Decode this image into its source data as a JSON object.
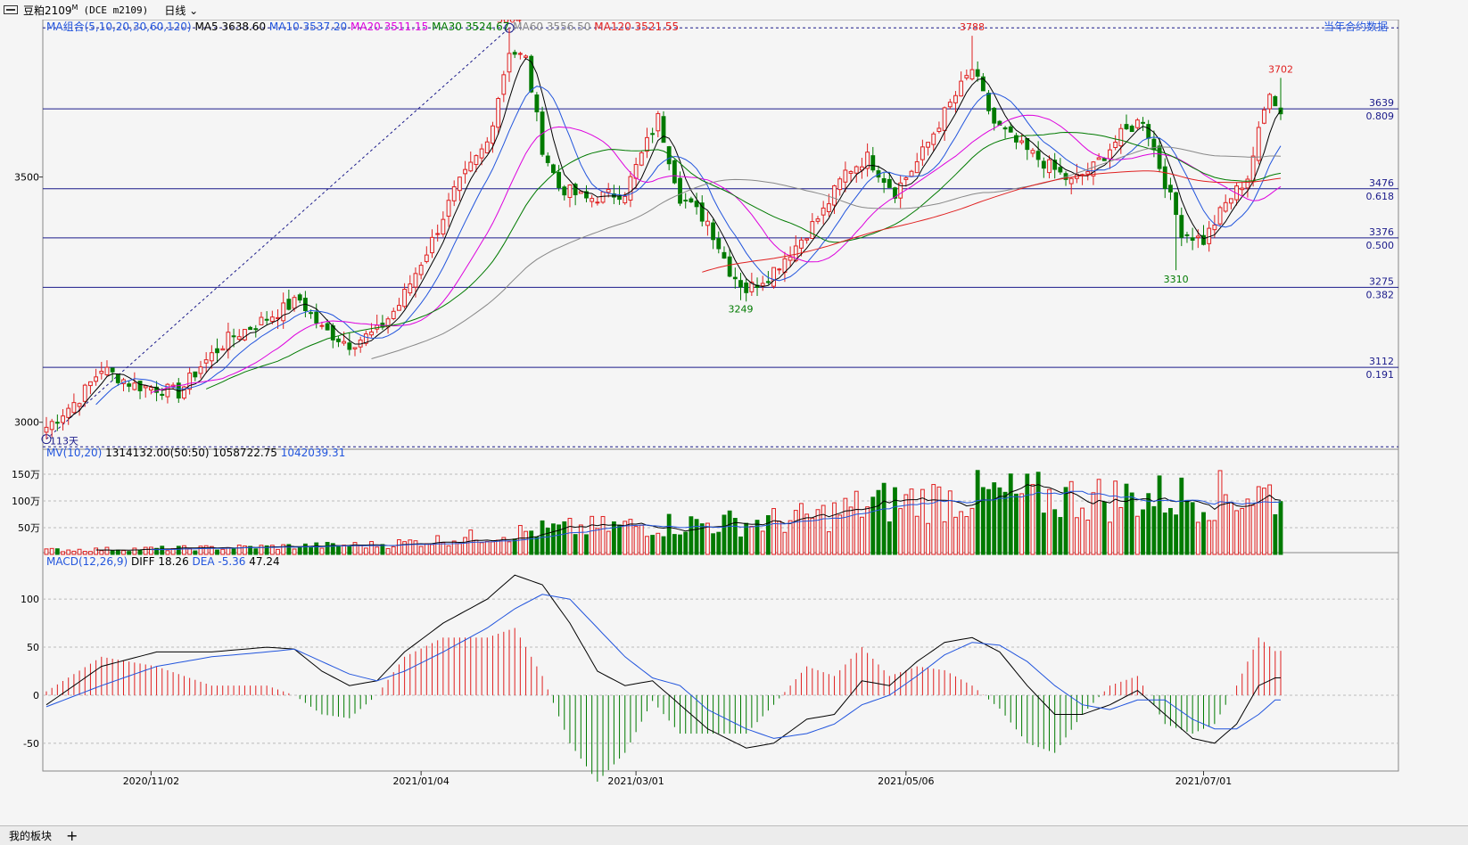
{
  "title": {
    "symbol": "豆粕2109",
    "superscript": "M",
    "code": "(DCE m2109)",
    "period": "日线"
  },
  "footer": {
    "tab": "我的板块",
    "add": "+"
  },
  "colors": {
    "up": "#e02020",
    "down": "#007a00",
    "ma5": "#000000",
    "ma10": "#2255dd",
    "ma20": "#dd00dd",
    "ma30": "#007a00",
    "ma60": "#888888",
    "ma120": "#e02020",
    "grid": "#bbbbbb",
    "fib": "#1a1a8a"
  },
  "chart_data": [
    {
      "type": "candlestick",
      "panel": "price",
      "indicator_label": "MA组合(5,10,20,30,60,120)",
      "legend": [
        {
          "name": "MA5",
          "value": "3638.60",
          "color": "#000000"
        },
        {
          "name": "MA10",
          "value": "3537.20",
          "color": "#2255dd"
        },
        {
          "name": "MA20",
          "value": "3511.15",
          "color": "#dd00dd"
        },
        {
          "name": "MA30",
          "value": "3524.67",
          "color": "#007a00"
        },
        {
          "name": "MA60",
          "value": "3556.50",
          "color": "#888888"
        },
        {
          "name": "MA120",
          "value": "3521.55",
          "color": "#e02020"
        }
      ],
      "right_link": "当年合约数据",
      "y_ticks": [
        3000,
        3500
      ],
      "ylim": [
        2945,
        3810
      ],
      "fib_levels": [
        {
          "price": 3639,
          "label": "3639",
          "ratio": "0.809"
        },
        {
          "price": 3476,
          "label": "3476",
          "ratio": "0.618"
        },
        {
          "price": 3376,
          "label": "3376",
          "ratio": "0.500"
        },
        {
          "price": 3275,
          "label": "3275",
          "ratio": "0.382"
        },
        {
          "price": 3112,
          "label": "3112",
          "ratio": "0.191"
        }
      ],
      "dashed_levels": [
        3804,
        2950
      ],
      "annotations": [
        {
          "label": "3804",
          "price": 3804,
          "bar": 84,
          "kind": "high"
        },
        {
          "label": "3788",
          "price": 3788,
          "bar": 168,
          "kind": "high"
        },
        {
          "label": "3702",
          "price": 3702,
          "bar": 224,
          "kind": "high"
        },
        {
          "label": "3249",
          "price": 3249,
          "bar": 126,
          "kind": "low"
        },
        {
          "label": "3310",
          "price": 3310,
          "bar": 205,
          "kind": "low"
        }
      ],
      "trend_line_label": "113天",
      "x_labels": [
        {
          "label": "2020/11/02",
          "bar": 19
        },
        {
          "label": "2021/01/04",
          "bar": 68
        },
        {
          "label": "2021/03/01",
          "bar": 107
        },
        {
          "label": "2021/05/06",
          "bar": 156
        },
        {
          "label": "2021/07/01",
          "bar": 210
        }
      ],
      "bars": 225,
      "close_anchors": [
        [
          0,
          2990
        ],
        [
          6,
          3050
        ],
        [
          10,
          3110
        ],
        [
          16,
          3075
        ],
        [
          20,
          3070
        ],
        [
          24,
          3060
        ],
        [
          28,
          3115
        ],
        [
          33,
          3170
        ],
        [
          38,
          3200
        ],
        [
          42,
          3225
        ],
        [
          46,
          3250
        ],
        [
          50,
          3190
        ],
        [
          55,
          3160
        ],
        [
          60,
          3185
        ],
        [
          64,
          3240
        ],
        [
          70,
          3370
        ],
        [
          74,
          3470
        ],
        [
          80,
          3570
        ],
        [
          84,
          3760
        ],
        [
          87,
          3740
        ],
        [
          90,
          3560
        ],
        [
          93,
          3480
        ],
        [
          98,
          3455
        ],
        [
          105,
          3470
        ],
        [
          111,
          3620
        ],
        [
          115,
          3460
        ],
        [
          120,
          3410
        ],
        [
          124,
          3310
        ],
        [
          127,
          3270
        ],
        [
          131,
          3300
        ],
        [
          136,
          3360
        ],
        [
          141,
          3430
        ],
        [
          145,
          3510
        ],
        [
          149,
          3540
        ],
        [
          154,
          3470
        ],
        [
          158,
          3530
        ],
        [
          163,
          3630
        ],
        [
          168,
          3720
        ],
        [
          172,
          3610
        ],
        [
          177,
          3560
        ],
        [
          181,
          3530
        ],
        [
          186,
          3490
        ],
        [
          190,
          3520
        ],
        [
          195,
          3585
        ],
        [
          199,
          3620
        ],
        [
          203,
          3490
        ],
        [
          206,
          3390
        ],
        [
          210,
          3370
        ],
        [
          214,
          3445
        ],
        [
          218,
          3500
        ],
        [
          222,
          3680
        ],
        [
          225,
          3604
        ]
      ]
    },
    {
      "type": "bar",
      "panel": "volume",
      "indicator_label": "MV(10,20)",
      "legend": [
        {
          "name": "",
          "value": "1314132.00(50:50)",
          "color": "#000000"
        },
        {
          "name": "",
          "value": "1058722.75",
          "color": "#000000"
        },
        {
          "name": "",
          "value": "1042039.31",
          "color": "#2255dd"
        }
      ],
      "y_ticks": [
        {
          "v": 150,
          "label": "150万"
        },
        {
          "v": 100,
          "label": "100万"
        },
        {
          "v": 50,
          "label": "50万"
        }
      ],
      "ylim": [
        0,
        160
      ],
      "vol_anchors": [
        [
          0,
          8
        ],
        [
          30,
          12
        ],
        [
          60,
          18
        ],
        [
          75,
          30
        ],
        [
          90,
          45
        ],
        [
          110,
          55
        ],
        [
          130,
          60
        ],
        [
          140,
          70
        ],
        [
          150,
          95
        ],
        [
          170,
          110
        ],
        [
          190,
          105
        ],
        [
          210,
          108
        ],
        [
          225,
          115
        ]
      ]
    },
    {
      "type": "line",
      "panel": "macd",
      "indicator_label": "MACD(12,26,9)",
      "legend": [
        {
          "name": "DIFF",
          "value": "18.26",
          "color": "#000000"
        },
        {
          "name": "DEA",
          "value": "-5.36",
          "color": "#2255dd"
        },
        {
          "name": "",
          "value": "47.24",
          "color": "#000000"
        }
      ],
      "y_ticks": [
        100,
        50,
        0,
        -50
      ],
      "ylim": [
        -78,
        128
      ],
      "diff_anchors": [
        [
          0,
          -10
        ],
        [
          10,
          30
        ],
        [
          20,
          45
        ],
        [
          30,
          45
        ],
        [
          40,
          50
        ],
        [
          45,
          48
        ],
        [
          50,
          25
        ],
        [
          55,
          10
        ],
        [
          60,
          15
        ],
        [
          65,
          45
        ],
        [
          72,
          75
        ],
        [
          80,
          100
        ],
        [
          85,
          125
        ],
        [
          90,
          115
        ],
        [
          95,
          75
        ],
        [
          100,
          25
        ],
        [
          105,
          10
        ],
        [
          110,
          15
        ],
        [
          115,
          -10
        ],
        [
          120,
          -35
        ],
        [
          127,
          -55
        ],
        [
          132,
          -50
        ],
        [
          138,
          -25
        ],
        [
          143,
          -20
        ],
        [
          148,
          15
        ],
        [
          153,
          10
        ],
        [
          158,
          35
        ],
        [
          163,
          55
        ],
        [
          168,
          60
        ],
        [
          173,
          45
        ],
        [
          178,
          10
        ],
        [
          183,
          -20
        ],
        [
          188,
          -20
        ],
        [
          193,
          -10
        ],
        [
          198,
          5
        ],
        [
          203,
          -20
        ],
        [
          208,
          -45
        ],
        [
          212,
          -50
        ],
        [
          216,
          -30
        ],
        [
          220,
          10
        ],
        [
          223,
          18
        ]
      ],
      "dea_anchors": [
        [
          0,
          -12
        ],
        [
          10,
          10
        ],
        [
          20,
          30
        ],
        [
          30,
          40
        ],
        [
          40,
          45
        ],
        [
          45,
          48
        ],
        [
          50,
          35
        ],
        [
          55,
          22
        ],
        [
          60,
          15
        ],
        [
          65,
          25
        ],
        [
          72,
          45
        ],
        [
          80,
          70
        ],
        [
          85,
          90
        ],
        [
          90,
          105
        ],
        [
          95,
          100
        ],
        [
          100,
          70
        ],
        [
          105,
          40
        ],
        [
          110,
          18
        ],
        [
          115,
          10
        ],
        [
          120,
          -15
        ],
        [
          127,
          -35
        ],
        [
          132,
          -45
        ],
        [
          138,
          -40
        ],
        [
          143,
          -30
        ],
        [
          148,
          -10
        ],
        [
          153,
          0
        ],
        [
          158,
          20
        ],
        [
          163,
          42
        ],
        [
          168,
          55
        ],
        [
          173,
          52
        ],
        [
          178,
          35
        ],
        [
          183,
          10
        ],
        [
          188,
          -10
        ],
        [
          193,
          -15
        ],
        [
          198,
          -5
        ],
        [
          203,
          -5
        ],
        [
          208,
          -25
        ],
        [
          212,
          -35
        ],
        [
          216,
          -35
        ],
        [
          220,
          -20
        ],
        [
          223,
          -5
        ]
      ]
    }
  ]
}
